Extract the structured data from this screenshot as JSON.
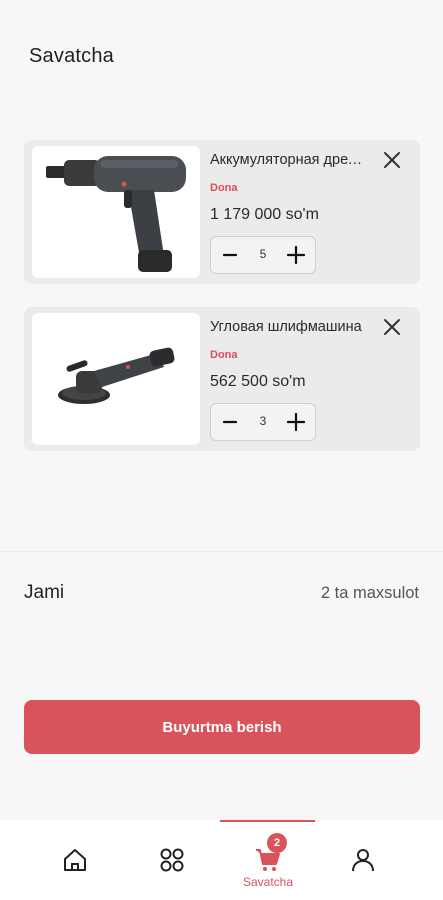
{
  "header": {
    "title": "Savatcha"
  },
  "cart": {
    "items": [
      {
        "title": "Аккумуляторная дрель-шуруповерт",
        "unit": "Dona",
        "price": "1 179 000 so'm",
        "quantity": "5",
        "image_icon": "cordless-drill-image"
      },
      {
        "title": "Угловая шлифмашина",
        "unit": "Dona",
        "price": "562 500 so'm",
        "quantity": "3",
        "image_icon": "angle-grinder-image"
      }
    ]
  },
  "summary": {
    "total_label": "Jami",
    "total_value": "2 ta maxsulot"
  },
  "checkout": {
    "label": "Buyurtma berish"
  },
  "nav": {
    "items": [
      {
        "icon": "home-icon",
        "label": ""
      },
      {
        "icon": "grid-icon",
        "label": ""
      },
      {
        "icon": "cart-icon",
        "label": "Savatcha",
        "badge": "2",
        "active": true
      },
      {
        "icon": "user-icon",
        "label": ""
      }
    ]
  },
  "colors": {
    "accent": "#d9535a",
    "background": "#f7f7f7",
    "card": "#ebebeb"
  }
}
